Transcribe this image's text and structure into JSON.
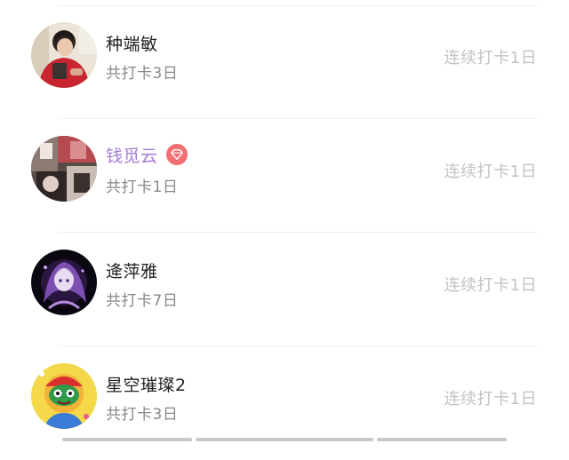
{
  "checkin_list": [
    {
      "name": "种端敏",
      "total_label": "共打卡3日",
      "streak_label": "连续打卡1日",
      "vip": false,
      "avatar_icon": "user-avatar-red-sweater"
    },
    {
      "name": "钱觅云",
      "total_label": "共打卡1日",
      "streak_label": "连续打卡1日",
      "vip": true,
      "vip_color": "#a579d6",
      "badge_color": "#f26f73",
      "avatar_icon": "user-avatar-photo-collage"
    },
    {
      "name": "逄萍雅",
      "total_label": "共打卡7日",
      "streak_label": "连续打卡1日",
      "vip": false,
      "avatar_icon": "user-avatar-anime-purple"
    },
    {
      "name": "星空璀璨2",
      "total_label": "共打卡3日",
      "streak_label": "连续打卡1日",
      "vip": false,
      "avatar_icon": "user-avatar-cartoon-yellow"
    }
  ]
}
